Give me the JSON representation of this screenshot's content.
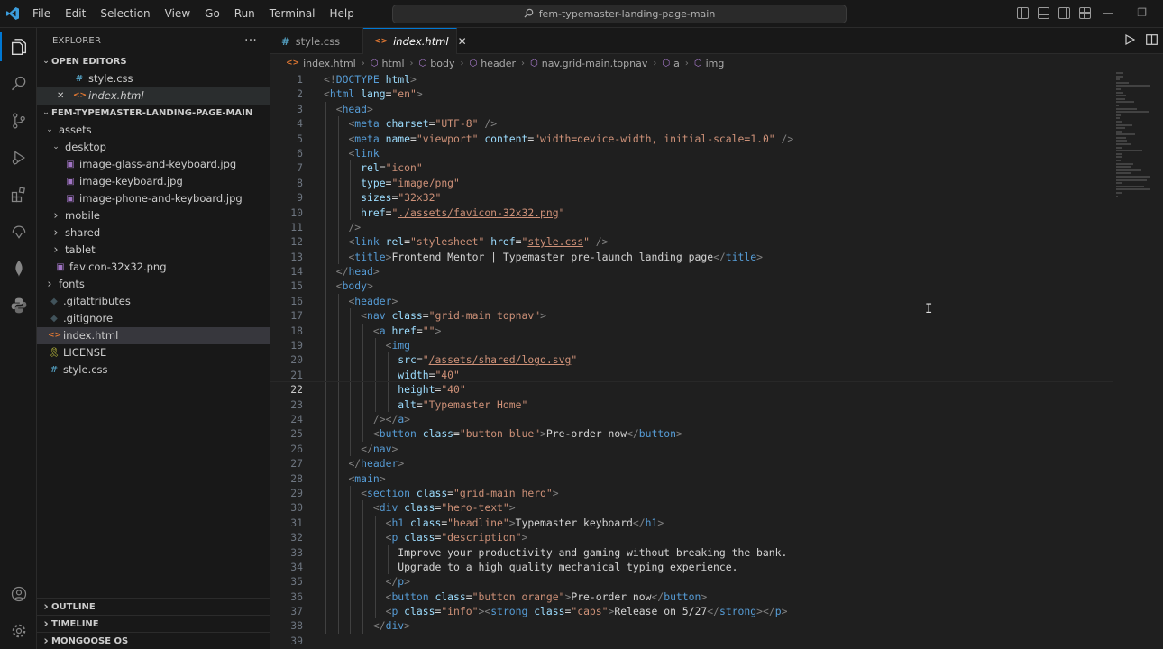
{
  "titlebar": {
    "menu": [
      "File",
      "Edit",
      "Selection",
      "View",
      "Go",
      "Run",
      "Terminal",
      "Help"
    ],
    "search": "fem-typemaster-landing-page-main",
    "accent": "#0078d4"
  },
  "activity": [
    "explorer-icon",
    "search-icon",
    "source-control-icon",
    "run-debug-icon",
    "extensions-icon",
    "remote-icon",
    "mongodb-leaf-icon",
    "python-icon"
  ],
  "sidebar": {
    "title": "EXPLORER",
    "more": "···",
    "open_editors_label": "OPEN EDITORS",
    "open_editors": [
      {
        "name": "style.css",
        "type": "css"
      },
      {
        "name": "index.html",
        "type": "html"
      }
    ],
    "project_label": "FEM-TYPEMASTER-LANDING-PAGE-MAIN",
    "tree": [
      {
        "name": "assets",
        "kind": "folder-open",
        "depth": 1
      },
      {
        "name": "desktop",
        "kind": "folder-open",
        "depth": 2
      },
      {
        "name": "image-glass-and-keyboard.jpg",
        "kind": "img",
        "depth": 3
      },
      {
        "name": "image-keyboard.jpg",
        "kind": "img",
        "depth": 3
      },
      {
        "name": "image-phone-and-keyboard.jpg",
        "kind": "img",
        "depth": 3
      },
      {
        "name": "mobile",
        "kind": "folder",
        "depth": 2
      },
      {
        "name": "shared",
        "kind": "folder",
        "depth": 2
      },
      {
        "name": "tablet",
        "kind": "folder",
        "depth": 2
      },
      {
        "name": "favicon-32x32.png",
        "kind": "img",
        "depth": 2
      },
      {
        "name": "fonts",
        "kind": "folder",
        "depth": 1
      },
      {
        "name": ".gitattributes",
        "kind": "git",
        "depth": 1
      },
      {
        "name": ".gitignore",
        "kind": "git",
        "depth": 1
      },
      {
        "name": "index.html",
        "kind": "html",
        "depth": 1,
        "selected": true
      },
      {
        "name": "LICENSE",
        "kind": "license",
        "depth": 1
      },
      {
        "name": "style.css",
        "kind": "css",
        "depth": 1
      }
    ],
    "bottom_sections": [
      "OUTLINE",
      "TIMELINE",
      "MONGOOSE OS"
    ]
  },
  "tabs": [
    {
      "label": "style.css",
      "type": "css",
      "active": false
    },
    {
      "label": "index.html",
      "type": "html",
      "active": true
    }
  ],
  "breadcrumb": [
    "index.html",
    "html",
    "body",
    "header",
    "nav.grid-main.topnav",
    "a",
    "img"
  ],
  "editor": {
    "current_line": 22,
    "lines": [
      [
        [
          "b",
          "<!"
        ],
        [
          "t",
          "DOCTYPE"
        ],
        [
          "x",
          " "
        ],
        [
          "a",
          "html"
        ],
        [
          "b",
          ">"
        ]
      ],
      [
        [
          "b",
          "<"
        ],
        [
          "t",
          "html"
        ],
        [
          "x",
          " "
        ],
        [
          "a",
          "lang"
        ],
        [
          "x",
          "="
        ],
        [
          "s",
          "\"en\""
        ],
        [
          "b",
          ">"
        ]
      ],
      [
        [
          "x",
          "  "
        ],
        [
          "b",
          "<"
        ],
        [
          "t",
          "head"
        ],
        [
          "b",
          ">"
        ]
      ],
      [
        [
          "x",
          "    "
        ],
        [
          "b",
          "<"
        ],
        [
          "t",
          "meta"
        ],
        [
          "x",
          " "
        ],
        [
          "a",
          "charset"
        ],
        [
          "x",
          "="
        ],
        [
          "s",
          "\"UTF-8\""
        ],
        [
          "x",
          " "
        ],
        [
          "b",
          "/>"
        ]
      ],
      [
        [
          "x",
          "    "
        ],
        [
          "b",
          "<"
        ],
        [
          "t",
          "meta"
        ],
        [
          "x",
          " "
        ],
        [
          "a",
          "name"
        ],
        [
          "x",
          "="
        ],
        [
          "s",
          "\"viewport\""
        ],
        [
          "x",
          " "
        ],
        [
          "a",
          "content"
        ],
        [
          "x",
          "="
        ],
        [
          "s",
          "\"width=device-width, initial-scale=1.0\""
        ],
        [
          "x",
          " "
        ],
        [
          "b",
          "/>"
        ]
      ],
      [
        [
          "x",
          "    "
        ],
        [
          "b",
          "<"
        ],
        [
          "t",
          "link"
        ]
      ],
      [
        [
          "x",
          "      "
        ],
        [
          "a",
          "rel"
        ],
        [
          "x",
          "="
        ],
        [
          "s",
          "\"icon\""
        ]
      ],
      [
        [
          "x",
          "      "
        ],
        [
          "a",
          "type"
        ],
        [
          "x",
          "="
        ],
        [
          "s",
          "\"image/png\""
        ]
      ],
      [
        [
          "x",
          "      "
        ],
        [
          "a",
          "sizes"
        ],
        [
          "x",
          "="
        ],
        [
          "s",
          "\"32x32\""
        ]
      ],
      [
        [
          "x",
          "      "
        ],
        [
          "a",
          "href"
        ],
        [
          "x",
          "="
        ],
        [
          "s",
          "\""
        ],
        [
          "u",
          "./assets/favicon-32x32.png"
        ],
        [
          "s",
          "\""
        ]
      ],
      [
        [
          "x",
          "    "
        ],
        [
          "b",
          "/>"
        ]
      ],
      [
        [
          "x",
          "    "
        ],
        [
          "b",
          "<"
        ],
        [
          "t",
          "link"
        ],
        [
          "x",
          " "
        ],
        [
          "a",
          "rel"
        ],
        [
          "x",
          "="
        ],
        [
          "s",
          "\"stylesheet\""
        ],
        [
          "x",
          " "
        ],
        [
          "a",
          "href"
        ],
        [
          "x",
          "="
        ],
        [
          "s",
          "\""
        ],
        [
          "u",
          "style.css"
        ],
        [
          "s",
          "\""
        ],
        [
          "x",
          " "
        ],
        [
          "b",
          "/>"
        ]
      ],
      [
        [
          "x",
          "    "
        ],
        [
          "b",
          "<"
        ],
        [
          "t",
          "title"
        ],
        [
          "b",
          ">"
        ],
        [
          "x",
          "Frontend Mentor | Typemaster pre-launch landing page"
        ],
        [
          "b",
          "</"
        ],
        [
          "t",
          "title"
        ],
        [
          "b",
          ">"
        ]
      ],
      [
        [
          "x",
          "  "
        ],
        [
          "b",
          "</"
        ],
        [
          "t",
          "head"
        ],
        [
          "b",
          ">"
        ]
      ],
      [
        [
          "x",
          "  "
        ],
        [
          "b",
          "<"
        ],
        [
          "t",
          "body"
        ],
        [
          "b",
          ">"
        ]
      ],
      [
        [
          "x",
          "    "
        ],
        [
          "b",
          "<"
        ],
        [
          "t",
          "header"
        ],
        [
          "b",
          ">"
        ]
      ],
      [
        [
          "x",
          "      "
        ],
        [
          "b",
          "<"
        ],
        [
          "t",
          "nav"
        ],
        [
          "x",
          " "
        ],
        [
          "a",
          "class"
        ],
        [
          "x",
          "="
        ],
        [
          "s",
          "\"grid-main topnav\""
        ],
        [
          "b",
          ">"
        ]
      ],
      [
        [
          "x",
          "        "
        ],
        [
          "b",
          "<"
        ],
        [
          "t",
          "a"
        ],
        [
          "x",
          " "
        ],
        [
          "a",
          "href"
        ],
        [
          "x",
          "="
        ],
        [
          "s",
          "\"\""
        ],
        [
          "b",
          ">"
        ]
      ],
      [
        [
          "x",
          "          "
        ],
        [
          "b",
          "<"
        ],
        [
          "t",
          "img"
        ]
      ],
      [
        [
          "x",
          "            "
        ],
        [
          "a",
          "src"
        ],
        [
          "x",
          "="
        ],
        [
          "s",
          "\""
        ],
        [
          "u",
          "/assets/shared/logo.svg"
        ],
        [
          "s",
          "\""
        ]
      ],
      [
        [
          "x",
          "            "
        ],
        [
          "a",
          "width"
        ],
        [
          "x",
          "="
        ],
        [
          "s",
          "\"40\""
        ]
      ],
      [
        [
          "x",
          "            "
        ],
        [
          "a",
          "height"
        ],
        [
          "x",
          "="
        ],
        [
          "s",
          "\"40\""
        ]
      ],
      [
        [
          "x",
          "            "
        ],
        [
          "a",
          "alt"
        ],
        [
          "x",
          "="
        ],
        [
          "s",
          "\"Typemaster Home\""
        ]
      ],
      [
        [
          "x",
          "        "
        ],
        [
          "b",
          "/></"
        ],
        [
          "t",
          "a"
        ],
        [
          "b",
          ">"
        ]
      ],
      [
        [
          "x",
          "        "
        ],
        [
          "b",
          "<"
        ],
        [
          "t",
          "button"
        ],
        [
          "x",
          " "
        ],
        [
          "a",
          "class"
        ],
        [
          "x",
          "="
        ],
        [
          "s",
          "\"button blue\""
        ],
        [
          "b",
          ">"
        ],
        [
          "x",
          "Pre-order now"
        ],
        [
          "b",
          "</"
        ],
        [
          "t",
          "button"
        ],
        [
          "b",
          ">"
        ]
      ],
      [
        [
          "x",
          "      "
        ],
        [
          "b",
          "</"
        ],
        [
          "t",
          "nav"
        ],
        [
          "b",
          ">"
        ]
      ],
      [
        [
          "x",
          "    "
        ],
        [
          "b",
          "</"
        ],
        [
          "t",
          "header"
        ],
        [
          "b",
          ">"
        ]
      ],
      [
        [
          "x",
          "    "
        ],
        [
          "b",
          "<"
        ],
        [
          "t",
          "main"
        ],
        [
          "b",
          ">"
        ]
      ],
      [
        [
          "x",
          "      "
        ],
        [
          "b",
          "<"
        ],
        [
          "t",
          "section"
        ],
        [
          "x",
          " "
        ],
        [
          "a",
          "class"
        ],
        [
          "x",
          "="
        ],
        [
          "s",
          "\"grid-main hero\""
        ],
        [
          "b",
          ">"
        ]
      ],
      [
        [
          "x",
          "        "
        ],
        [
          "b",
          "<"
        ],
        [
          "t",
          "div"
        ],
        [
          "x",
          " "
        ],
        [
          "a",
          "class"
        ],
        [
          "x",
          "="
        ],
        [
          "s",
          "\"hero-text\""
        ],
        [
          "b",
          ">"
        ]
      ],
      [
        [
          "x",
          "          "
        ],
        [
          "b",
          "<"
        ],
        [
          "t",
          "h1"
        ],
        [
          "x",
          " "
        ],
        [
          "a",
          "class"
        ],
        [
          "x",
          "="
        ],
        [
          "s",
          "\"headline\""
        ],
        [
          "b",
          ">"
        ],
        [
          "x",
          "Typemaster keyboard"
        ],
        [
          "b",
          "</"
        ],
        [
          "t",
          "h1"
        ],
        [
          "b",
          ">"
        ]
      ],
      [
        [
          "x",
          "          "
        ],
        [
          "b",
          "<"
        ],
        [
          "t",
          "p"
        ],
        [
          "x",
          " "
        ],
        [
          "a",
          "class"
        ],
        [
          "x",
          "="
        ],
        [
          "s",
          "\"description\""
        ],
        [
          "b",
          ">"
        ]
      ],
      [
        [
          "x",
          "            Improve your productivity and gaming without breaking the bank."
        ]
      ],
      [
        [
          "x",
          "            Upgrade to a high quality mechanical typing experience."
        ]
      ],
      [
        [
          "x",
          "          "
        ],
        [
          "b",
          "</"
        ],
        [
          "t",
          "p"
        ],
        [
          "b",
          ">"
        ]
      ],
      [
        [
          "x",
          "          "
        ],
        [
          "b",
          "<"
        ],
        [
          "t",
          "button"
        ],
        [
          "x",
          " "
        ],
        [
          "a",
          "class"
        ],
        [
          "x",
          "="
        ],
        [
          "s",
          "\"button orange\""
        ],
        [
          "b",
          ">"
        ],
        [
          "x",
          "Pre-order now"
        ],
        [
          "b",
          "</"
        ],
        [
          "t",
          "button"
        ],
        [
          "b",
          ">"
        ]
      ],
      [
        [
          "x",
          "          "
        ],
        [
          "b",
          "<"
        ],
        [
          "t",
          "p"
        ],
        [
          "x",
          " "
        ],
        [
          "a",
          "class"
        ],
        [
          "x",
          "="
        ],
        [
          "s",
          "\"info\""
        ],
        [
          "b",
          ">"
        ],
        [
          "b",
          "<"
        ],
        [
          "t",
          "strong"
        ],
        [
          "x",
          " "
        ],
        [
          "a",
          "class"
        ],
        [
          "x",
          "="
        ],
        [
          "s",
          "\"caps\""
        ],
        [
          "b",
          ">"
        ],
        [
          "x",
          "Release on 5/27"
        ],
        [
          "b",
          "</"
        ],
        [
          "t",
          "strong"
        ],
        [
          "b",
          ">"
        ],
        [
          "b",
          "</"
        ],
        [
          "t",
          "p"
        ],
        [
          "b",
          ">"
        ]
      ],
      [
        [
          "x",
          "        "
        ],
        [
          "b",
          "</"
        ],
        [
          "t",
          "div"
        ],
        [
          "b",
          ">"
        ]
      ],
      [
        [
          "x",
          ""
        ]
      ]
    ]
  }
}
